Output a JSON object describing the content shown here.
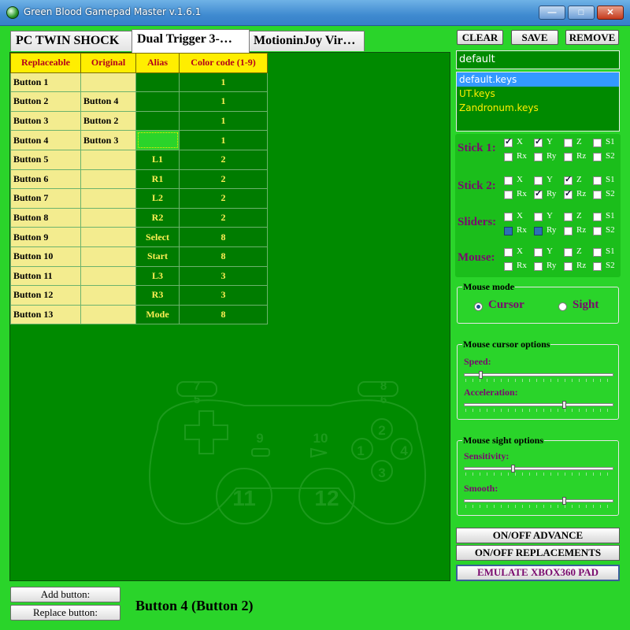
{
  "window": {
    "title": "Green Blood Gamepad Master v.1.6.1",
    "min": "—",
    "max": "□",
    "close": "✕"
  },
  "tabs": [
    {
      "label": "PC TWIN SHOCK",
      "active": false
    },
    {
      "label": "Dual Trigger 3-…",
      "active": true
    },
    {
      "label": "MotioninJoy Vir…",
      "active": false
    }
  ],
  "table": {
    "headers": [
      "Replaceable",
      "Original",
      "Alias",
      "Color code (1-9)"
    ],
    "rows": [
      {
        "replaceable": "Button 1",
        "original": "",
        "alias": "",
        "color": "1"
      },
      {
        "replaceable": "Button 2",
        "original": "Button 4",
        "alias": "",
        "color": "1"
      },
      {
        "replaceable": "Button 3",
        "original": "Button 2",
        "alias": "",
        "color": "1"
      },
      {
        "replaceable": "Button 4",
        "original": "Button 3",
        "alias": "",
        "color": "1"
      },
      {
        "replaceable": "Button 5",
        "original": "",
        "alias": "L1",
        "color": "2"
      },
      {
        "replaceable": "Button 6",
        "original": "",
        "alias": "R1",
        "color": "2"
      },
      {
        "replaceable": "Button 7",
        "original": "",
        "alias": "L2",
        "color": "2"
      },
      {
        "replaceable": "Button 8",
        "original": "",
        "alias": "R2",
        "color": "2"
      },
      {
        "replaceable": "Button 9",
        "original": "",
        "alias": "Select",
        "color": "8"
      },
      {
        "replaceable": "Button 10",
        "original": "",
        "alias": "Start",
        "color": "8"
      },
      {
        "replaceable": "Button 11",
        "original": "",
        "alias": "L3",
        "color": "3"
      },
      {
        "replaceable": "Button 12",
        "original": "",
        "alias": "R3",
        "color": "3"
      },
      {
        "replaceable": "Button 13",
        "original": "",
        "alias": "Mode",
        "color": "8"
      }
    ]
  },
  "gamepad": {
    "labels": [
      "7",
      "5",
      "8",
      "6",
      "9",
      "10",
      "2",
      "1",
      "4",
      "3",
      "11",
      "12"
    ]
  },
  "bottom": {
    "add_label": "Add button:",
    "replace_label": "Replace button:",
    "status": "Button 4 (Button 2)"
  },
  "toolbar": {
    "clear": "CLEAR",
    "save": "SAVE",
    "remove": "REMOVE"
  },
  "profile": {
    "name": "default",
    "files": [
      "default.keys",
      "UT.keys",
      "Zandronum.keys"
    ],
    "selected_index": 0
  },
  "axes": {
    "rows": [
      {
        "label": "Stick 1:",
        "checks": {
          "X": true,
          "Y": true,
          "Z": false,
          "S1": false,
          "Rx": false,
          "Ry": false,
          "Rz": false,
          "S2": false
        }
      },
      {
        "label": "Stick 2:",
        "checks": {
          "X": false,
          "Y": false,
          "Z": true,
          "S1": false,
          "Rx": false,
          "Ry": true,
          "Rz": true,
          "S2": false
        }
      },
      {
        "label": "Sliders:",
        "checks": {
          "X": false,
          "Y": false,
          "Z": false,
          "S1": false,
          "Rx": true,
          "Ry": true,
          "Rz": false,
          "S2": false
        }
      },
      {
        "label": "Mouse:",
        "checks": {
          "X": false,
          "Y": false,
          "Z": false,
          "S1": false,
          "Rx": false,
          "Ry": false,
          "Rz": false,
          "S2": false
        }
      }
    ],
    "names": [
      "X",
      "Y",
      "Z",
      "S1",
      "Rx",
      "Ry",
      "Rz",
      "S2"
    ]
  },
  "mouse_mode": {
    "title": "Mouse mode",
    "cursor": "Cursor",
    "sight": "Sight",
    "selected": "Cursor"
  },
  "cursor_options": {
    "title": "Mouse cursor options",
    "speed_label": "Speed:",
    "speed": 0.1,
    "accel_label": "Acceleration:",
    "accel": 0.67
  },
  "sight_options": {
    "title": "Mouse sight options",
    "sens_label": "Sensitivity:",
    "sens": 0.32,
    "smooth_label": "Smooth:",
    "smooth": 0.67
  },
  "actions": {
    "advance": "ON/OFF ADVANCE",
    "replacements": "ON/OFF REPLACEMENTS",
    "xbox": "EMULATE XBOX360 PAD"
  },
  "colors": {
    "background": "#2ad42a",
    "panel": "#008a00",
    "accent": "#ffee00",
    "label": "#7a0a6e"
  }
}
